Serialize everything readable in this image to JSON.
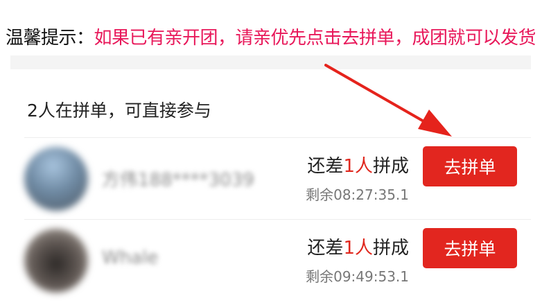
{
  "tip": {
    "prefix": "温馨提示：",
    "text": "如果已有亲开团，请亲优先点击去拼单，成团就可以发货"
  },
  "group": {
    "title": "2人在拼单，可直接参与",
    "members": [
      {
        "name": "方伟188****3039",
        "status_prefix": "还差",
        "count": "1人",
        "status_suffix": "拼成",
        "remaining": "剩余08:27:35.1",
        "button": "去拼单"
      },
      {
        "name": "Whale",
        "status_prefix": "还差",
        "count": "1人",
        "status_suffix": "拼成",
        "remaining": "剩余09:49:53.1",
        "button": "去拼单"
      }
    ]
  },
  "colors": {
    "accent": "#e2261f",
    "tip_text": "#e8185a",
    "arrow": "#e5231c"
  }
}
